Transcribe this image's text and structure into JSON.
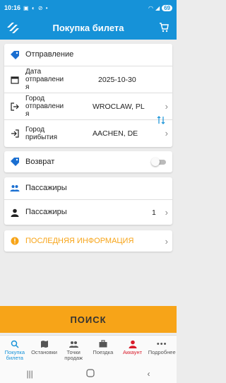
{
  "status_bar": {
    "time": "10:16",
    "battery": "69"
  },
  "header": {
    "title": "Покупка билета"
  },
  "departure_section": {
    "title": "Отправление",
    "date_label": "Дата\nотправлени\nя",
    "date_value": "2025-10-30",
    "from_label": "Город\nотправлени\nя",
    "from_value": "WROCLAW, PL",
    "to_label": "Город\nприбытия",
    "to_value": "AACHEN, DE"
  },
  "return_section": {
    "label": "Возврат",
    "enabled": false
  },
  "passengers_section": {
    "title": "Пассажиры",
    "row_label": "Пассажиры",
    "count": "1"
  },
  "info_banner": {
    "label": "ПОСЛЕДНЯЯ ИНФОРМАЦИЯ"
  },
  "search_button": {
    "label": "ПОИСК"
  },
  "bottom_nav": [
    {
      "label": "Покупка\nбилета",
      "icon": "search-icon"
    },
    {
      "label": "Остановки",
      "icon": "map-icon"
    },
    {
      "label": "Точки\nпродаж",
      "icon": "people-icon"
    },
    {
      "label": "Поездка",
      "icon": "briefcase-icon"
    },
    {
      "label": "Аккаунт",
      "icon": "account-icon"
    },
    {
      "label": "Подробнее",
      "icon": "more-icon"
    }
  ],
  "colors": {
    "primary": "#1692d8",
    "accent": "#f7a418",
    "account_red": "#d91b2a",
    "info_text": "#f7a418"
  }
}
